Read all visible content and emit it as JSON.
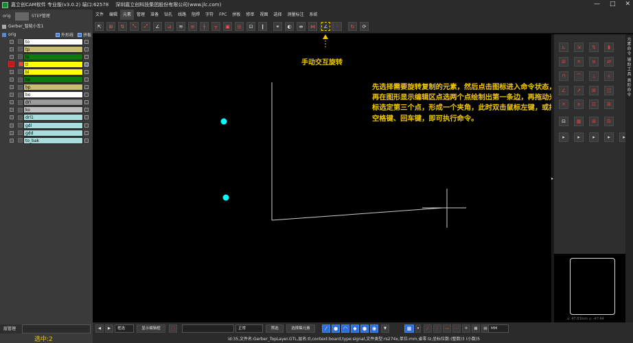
{
  "titlebar": {
    "title": "嘉立创CAM软件 专业版(v3.0.2) 端口:62578",
    "company": "深圳嘉立创科技集团股份有限公司(www.jlc.com)",
    "minimize": "—",
    "maximize": "□",
    "close": "✕"
  },
  "left": {
    "tab_orig": "orig",
    "tab_step": "STEP管理",
    "job": "Gerber_智能小车1",
    "step": "orig",
    "outline_label": "外形线",
    "panel_label": "拼板",
    "layers": [
      {
        "name": "to",
        "color": "#ffffff"
      },
      {
        "name": "tp",
        "color": "#c8bf6e"
      },
      {
        "name": "ts",
        "color": "#0c7a0c"
      },
      {
        "name": "tl",
        "color": "#ffff00"
      },
      {
        "name": "bl",
        "color": "#ffff00"
      },
      {
        "name": "bs",
        "color": "#0c7a0c"
      },
      {
        "name": "bp",
        "color": "#c8bf6e"
      },
      {
        "name": "bo",
        "color": "#ffffff"
      },
      {
        "name": "drl",
        "color": "#9c9c9c"
      },
      {
        "name": "ko",
        "color": "#c0c0c0"
      },
      {
        "name": "drl1",
        "color": "#a8dede"
      },
      {
        "name": "gdl",
        "color": "#a8dede"
      },
      {
        "name": "gdd",
        "color": "#a8dede"
      },
      {
        "name": "to_bak",
        "color": "#a8dede"
      }
    ],
    "layer_manager": "层管理",
    "selected_count": "选中:2"
  },
  "menu": [
    "文件",
    "编辑",
    "元素",
    "管理",
    "准备",
    "钻孔",
    "线路",
    "阻焊",
    "字符",
    "FPC",
    "拼板",
    "修审",
    "视图",
    "选择",
    "测量标注",
    "系统"
  ],
  "canvas": {
    "annotation_label": "手动交互旋转",
    "annotation_text": "先选择需要旋转复制的元素，然后点击图标进入命令状态，再在图形显示编辑区点选两个点绘制出第一条边，再拖动光标选定第三个点，形成一个夹角，此时双击鼠标左键，或按空格键、回车键，即可执行命令。"
  },
  "right": {
    "vtabs": [
      "元素命令",
      "辅助工具",
      "高阶命令"
    ],
    "minimap_coords": "x: 47.83mm  y: -47.44"
  },
  "bottombar": {
    "mode": "框选",
    "show_edit": "显示编辑框",
    "normal": "正常",
    "filter": "筛选",
    "selected_elements": "选择集元素",
    "unit": "MM"
  },
  "status": {
    "text": "id:35,文件名:Gerber_TopLayer.GTL,层名:tl,context:board,type:signal,文件类型:rs274x,单位:mm,省零:lz,坐标位数:(整数)3 (小数)5"
  },
  "colors": {
    "accent": "#f0c800",
    "dot": "#00ffff",
    "active_layer_marker": "#e02020"
  }
}
